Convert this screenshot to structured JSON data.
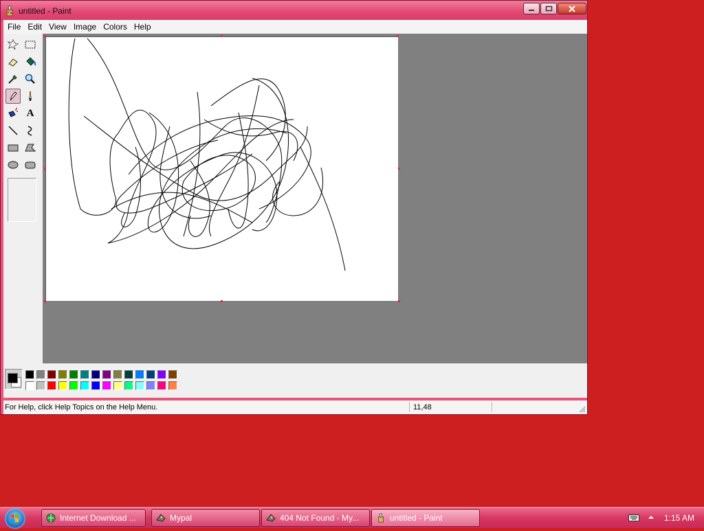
{
  "window": {
    "title": "untitled - Paint"
  },
  "menu": [
    "File",
    "Edit",
    "View",
    "Image",
    "Colors",
    "Help"
  ],
  "tools": [
    {
      "name": "free-form-select-icon"
    },
    {
      "name": "select-icon"
    },
    {
      "name": "eraser-icon"
    },
    {
      "name": "fill-bucket-icon"
    },
    {
      "name": "color-picker-icon"
    },
    {
      "name": "magnifier-icon"
    },
    {
      "name": "pencil-icon",
      "active": true
    },
    {
      "name": "brush-icon"
    },
    {
      "name": "airbrush-icon"
    },
    {
      "name": "text-icon",
      "glyph": "A"
    },
    {
      "name": "line-icon"
    },
    {
      "name": "curve-icon"
    },
    {
      "name": "rectangle-icon"
    },
    {
      "name": "polygon-icon"
    },
    {
      "name": "ellipse-icon"
    },
    {
      "name": "rounded-rectangle-icon"
    }
  ],
  "palette": {
    "foreground": "#000000",
    "background": "#ffffff",
    "row1": [
      "#000000",
      "#808080",
      "#800000",
      "#808000",
      "#008000",
      "#008080",
      "#000080",
      "#800080",
      "#808040",
      "#004040",
      "#0080ff",
      "#004080",
      "#8000ff",
      "#804000"
    ],
    "row2": [
      "#ffffff",
      "#c0c0c0",
      "#ff0000",
      "#ffff00",
      "#00ff00",
      "#00ffff",
      "#0000ff",
      "#ff00ff",
      "#ffff80",
      "#00ff80",
      "#80ffff",
      "#8080ff",
      "#ff0080",
      "#ff8040"
    ]
  },
  "status": {
    "help_text": "For Help, click Help Topics on the Help Menu.",
    "coords": "11,48"
  },
  "taskbar": {
    "items": [
      {
        "label": "Internet Download ...",
        "icon": "globe-icon"
      },
      {
        "label": "Mypal",
        "icon": "mypal-icon"
      },
      {
        "label": "404 Not Found - My...",
        "icon": "mypal-icon"
      },
      {
        "label": "untitled - Paint",
        "icon": "paint-icon",
        "active": true
      }
    ],
    "clock": "1:15 AM"
  }
}
